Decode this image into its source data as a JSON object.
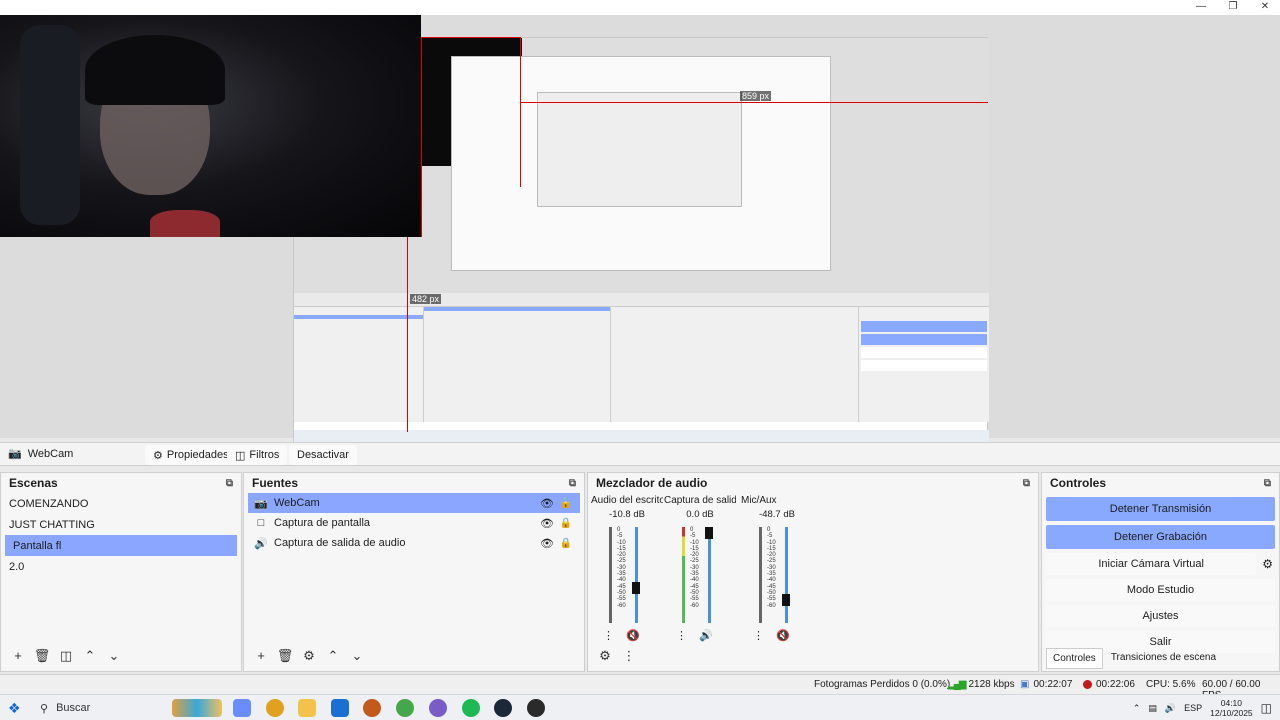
{
  "source_toolbar": {
    "source_name": "WebCam",
    "properties_label": "Propiedades",
    "filters_label": "Filtros",
    "deactivate_label": "Desactivar"
  },
  "preview": {
    "measure_right": "859 px",
    "measure_top": "482 px"
  },
  "scenes": {
    "title": "Escenas",
    "items": [
      {
        "label": "COMENZANDO"
      },
      {
        "label": "JUST CHATTING"
      },
      {
        "label": "Pantalla fl"
      },
      {
        "label": "2.0"
      }
    ]
  },
  "sources": {
    "title": "Fuentes",
    "items": [
      {
        "label": "WebCam",
        "icon": "camera-icon"
      },
      {
        "label": "Captura de pantalla",
        "icon": "monitor-icon"
      },
      {
        "label": "Captura de salida de audio",
        "icon": "speaker-icon"
      }
    ]
  },
  "mixer": {
    "title": "Mezclador de audio",
    "channels": [
      {
        "name": "Audio del escritorio",
        "db": "-10.8 dB",
        "level": 0.35,
        "muted": true
      },
      {
        "name": "Captura de salida",
        "db": "0.0 dB",
        "level": 1.0,
        "muted": false
      },
      {
        "name": "Mic/Aux",
        "db": "-48.7 dB",
        "level": 0.2,
        "muted": true
      }
    ],
    "scale": [
      "0",
      "-5",
      "-10",
      "-15",
      "-20",
      "-25",
      "-30",
      "-35",
      "-40",
      "-45",
      "-50",
      "-55",
      "-60"
    ]
  },
  "controls": {
    "title": "Controles",
    "stop_stream": "Detener Transmisión",
    "stop_record": "Detener Grabación",
    "virtual_cam": "Iniciar Cámara Virtual",
    "studio_mode": "Modo Estudio",
    "settings": "Ajustes",
    "exit": "Salir",
    "tab_controls": "Controles",
    "tab_transitions": "Transiciones de escena"
  },
  "status": {
    "dropped": "Fotogramas Perdidos 0 (0.0%)",
    "bitrate": "2128 kbps",
    "stream_time": "00:22:07",
    "record_time": "00:22:06",
    "cpu": "CPU: 5.6%",
    "fps": "60.00 / 60.00 FPS"
  },
  "taskbar": {
    "search_label": "Buscar",
    "lang": "ESP",
    "time": "04:10",
    "date": "12/10/2025"
  },
  "colors": {
    "accent": "#88a9ff",
    "record_red": "#c41a1a",
    "measure_red": "#e00000"
  }
}
